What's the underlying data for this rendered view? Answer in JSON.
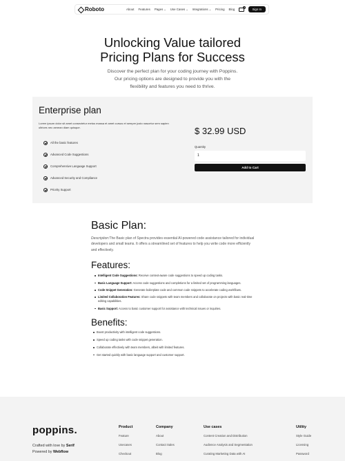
{
  "nav": {
    "logo": "Roboto",
    "links": [
      "About",
      "Features"
    ],
    "dropdowns": [
      "Pages",
      "Use Cases",
      "Integrations"
    ],
    "links2": [
      "Pricing",
      "Blog"
    ],
    "cart_count": "0",
    "signin": "Sign In"
  },
  "hero": {
    "title_line1": "Unlocking Value tailored",
    "title_line2": "Pricing Plans for Success",
    "subtitle": "Discover the perfect plan for your coding journey with Poppins. Our pricing options are designed to provide you with the flexibility and features you need to thrive."
  },
  "enterprise": {
    "title": "Enterprise plan",
    "description": "Lorem ipsum dolor sit amet consectetur metus massa et amet cursus et semper justo nascetur sem sapien ultrices nec aenean diam quisque.",
    "features": [
      "All the basic features",
      "Advanced Code Suggestions",
      "Comprehensive Language Support",
      "Advanced Security and Compliance",
      "Priority Support"
    ],
    "price": "$ 32.99 USD",
    "quantity_label": "Quantity",
    "quantity_value": "1",
    "cart_button": "Add to Cart"
  },
  "basic": {
    "title": "Basic Plan:",
    "desc_lead": "Description:",
    "description": "The Basic plan of Spectra provides essential AI-powered code assistance tailored for individual developers and small teams. It offers a streamlined set of features to help you write code more efficiently and effectively.",
    "features_title": "Features:",
    "features": [
      {
        "name": "Intelligent Code Suggestions:",
        "text": " Receive context-aware code suggestions to speed up coding tasks."
      },
      {
        "name": "Basic Language Support:",
        "text": " Access code suggestions and completions for a limited set of programming languages."
      },
      {
        "name": "Code Snippet Generation:",
        "text": " Generate boilerplate code and common code snippets to accelerate coding workflows."
      },
      {
        "name": "Limited Collaboration Features:",
        "text": " Share code snippets with team members and collaborate on projects with basic real-time editing capabilities."
      },
      {
        "name": "Basic Support:",
        "text": " Access to basic customer support for assistance with technical issues or inquiries."
      }
    ],
    "benefits_title": "Benefits:",
    "benefits": [
      "Boost productivity with intelligent code suggestions.",
      "Speed up coding tasks with code snippet generation.",
      "Collaborate effectively with team members, albeit with limited features.",
      "Get started quickly with basic language support and customer support."
    ]
  },
  "footer": {
    "logo": "poppins",
    "crafted": "Crafted with love by",
    "crafted_by": "Serif",
    "powered": "Powered by",
    "powered_by": "Webflow",
    "columns": [
      {
        "title": "Product",
        "links": [
          "Feature",
          "Usecases",
          "Checkout"
        ]
      },
      {
        "title": "Company",
        "links": [
          "About",
          "Contact Sales",
          "Blog"
        ]
      },
      {
        "title": "Use cases",
        "links": [
          "Content Creation and Distribution",
          "Audience Analysis and Segmentation",
          "Curating Marketing Data with AI"
        ]
      },
      {
        "title": "Utility",
        "links": [
          "Style Guide",
          "Licensing",
          "Password"
        ]
      }
    ]
  }
}
